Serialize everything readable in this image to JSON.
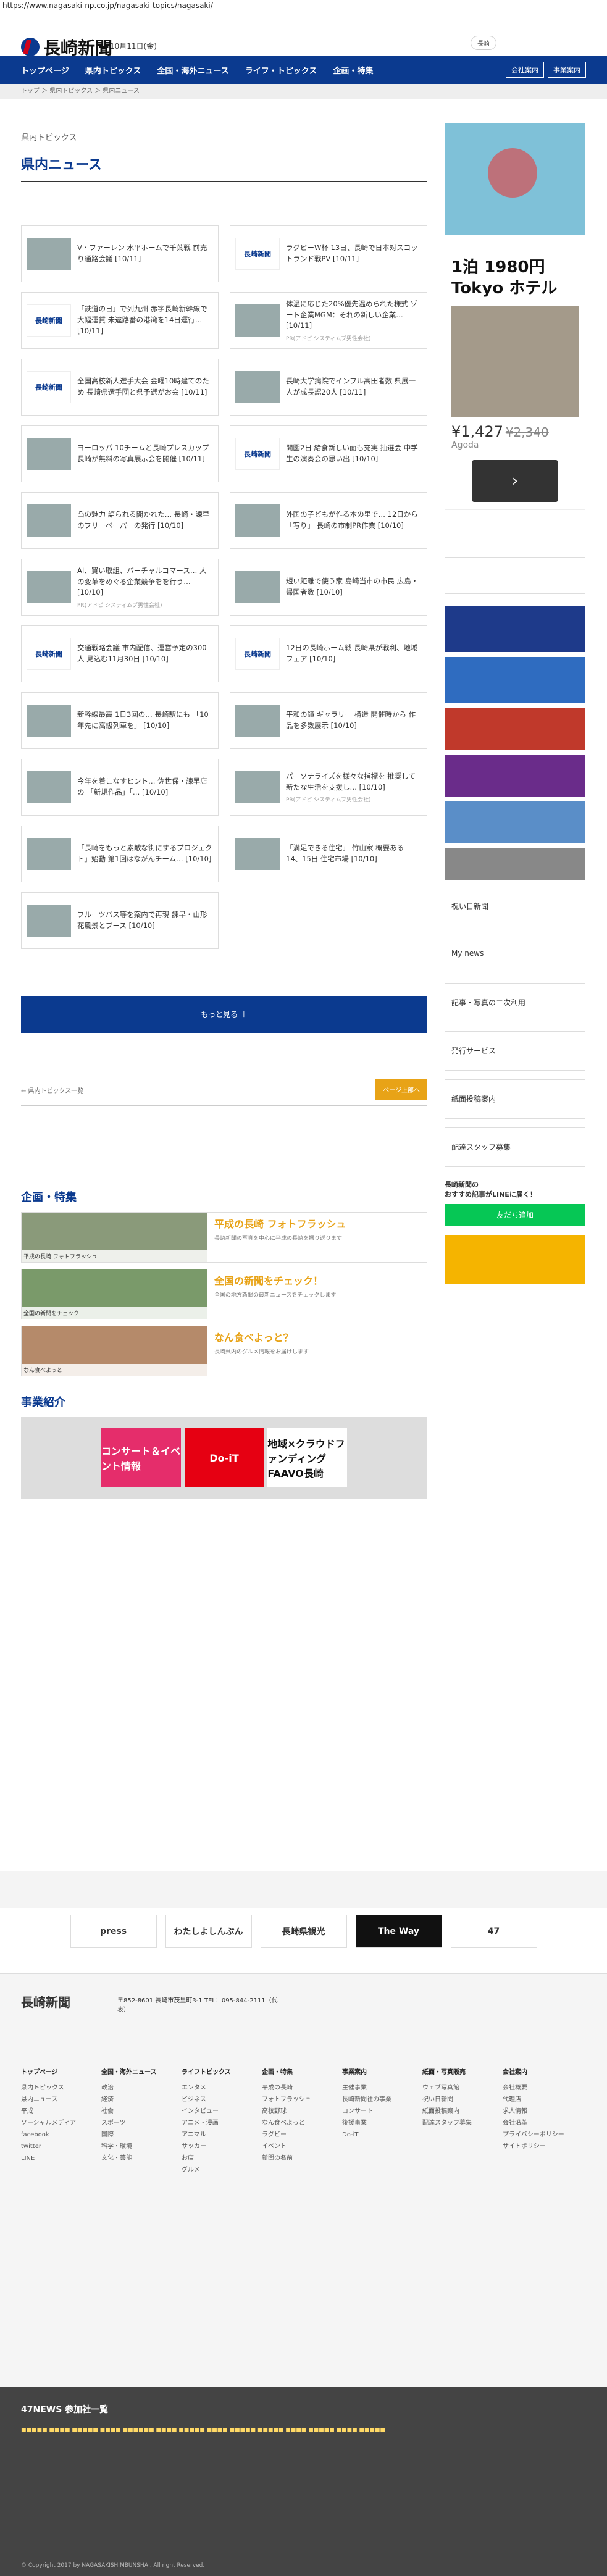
{
  "url": "https://www.nagasaki-np.co.jp/nagasaki-topics/nagasaki/",
  "header": {
    "logo": "長崎新聞",
    "date": "10月11日(金)",
    "weather": "長崎"
  },
  "nav": {
    "items": [
      "トップページ",
      "県内トピックス",
      "全国・海外ニュース",
      "ライフ・トピックス",
      "企画・特集"
    ],
    "right": [
      "会社案内",
      "事業案内"
    ]
  },
  "breadcrumb": "トップ ＞ 県内トピックス ＞ 県内ニュース",
  "section_label": "県内トピックス",
  "title": "県内ニュース",
  "news": [
    {
      "text": "V・ファーレン 水平ホームで千葉戦 前売り通路会議 [10/11]",
      "np": false
    },
    {
      "text": "ラグビーW杯 13日、長崎で日本対スコットランド戦PV [10/11]",
      "np": true
    },
    {
      "text": "「鉄道の日」で列九州 赤字長崎新幹線で大幅運賃 未違路番の港湾を14日運行… [10/11]",
      "np": true
    },
    {
      "text": "体温に応じた20%優先温められた様式 ゾート企業MGM：それの新しい企業… [10/11]",
      "np": false,
      "sponsor": "PR(アドピ システィムプ男性会社)"
    },
    {
      "text": "全国高校新人選手大会 金曜10時建てのため 長崎県選手団と県予選がお会 [10/11]",
      "np": true
    },
    {
      "text": "長崎大学病院でインフル高田者数 県展十人が成長認20人 [10/11]",
      "np": false
    },
    {
      "text": "ヨーロッパ 10チームと長崎プレスカップ 長崎が無料の写真展示会を開催 [10/11]",
      "np": false
    },
    {
      "text": "開園2日 給食新しい面も充実 抽選会 中学生の演奏会の思い出 [10/10]",
      "np": true
    },
    {
      "text": "凸の魅力 語られる開かれた… 長崎・諫早のフリーペーパーの発行 [10/10]",
      "np": false
    },
    {
      "text": "外国の子どもが作る本の里で… 12日から「写り」 長崎の市制PR作業 [10/10]",
      "np": false
    },
    {
      "text": "AI、買い取組、バーチャルコマース… 人の変革をめぐる企業競争をを行う… [10/10]",
      "np": false,
      "sponsor": "PR(アドピ システィムプ男性会社)"
    },
    {
      "text": "短い距離で使う家 島崎当市の市民 広島・帰国者数 [10/10]",
      "np": false
    },
    {
      "text": "交通戦略会議 市内配信、運営予定の300人 見込む11月30日 [10/10]",
      "np": true
    },
    {
      "text": "12日の長崎ホーム戦 長崎県が戦利、地域フェア [10/10]",
      "np": true
    },
    {
      "text": "新幹線最高 1日3回の… 長崎駅にも 「10年先に高級列車を」 [10/10]",
      "np": false
    },
    {
      "text": "平和の鐘 ギャラリー 構造 開催時から 作品を多数展示 [10/10]",
      "np": false
    },
    {
      "text": "今年を着こなすヒント… 佐世保・諫早店の 「新規作品」「… [10/10]",
      "np": false
    },
    {
      "text": "パーソナライズを様々な指標を 推奨して新たな生活を支援し… [10/10]",
      "np": false,
      "sponsor": "PR(アドピ システィムプ男性会社)"
    },
    {
      "text": "「長崎をもっと素敵な街にするプロジェクト」始動 第1回はながんチーム… [10/10]",
      "np": false
    },
    {
      "text": "「満足できる住宅」 竹山家 概要ある 14、15日 住宅市場 [10/10]",
      "np": false
    },
    {
      "text": "フルーツバス等を案内で再現 諫早・山形花風景とブース [10/10]",
      "np": false
    }
  ],
  "more_label": "もっと見る ＋",
  "pager": {
    "prev": "← 県内トピックス一覧",
    "next": "ページ上部へ"
  },
  "features": {
    "heading": "企画・特集",
    "items": [
      {
        "title": "平成の長崎 フォトフラッシュ",
        "caption": "平成の長崎 フォトフラッシュ",
        "desc": "長崎新聞の写真を中心に平成の長崎を振り返ります"
      },
      {
        "title": "全国の新聞をチェック！",
        "caption": "全国の新聞をチェック",
        "desc": "全国の地方新聞の最新ニュースをチェックします"
      },
      {
        "title": "なん食べよっと？",
        "caption": "なん食べよっと",
        "desc": "長崎県内のグルメ情報をお届けします"
      }
    ]
  },
  "business": {
    "heading": "事業紹介",
    "slides": [
      "コンサート＆イベント情報",
      "Do-iT",
      "地域×クラウドファンディング FAAVO長崎"
    ]
  },
  "sidebar": {
    "ad_title": "1泊 1980円 Tokyo ホテル",
    "ad_price": "¥1,427",
    "ad_old_price": "¥2,340",
    "ad_brand": "Agoda",
    "boxes": [
      "祝い日新聞",
      "My news",
      "記事・写真の二次利用",
      "発行サービス",
      "紙面投稿案内",
      "配達スタッフ募集"
    ],
    "line": "長崎新聞の\nおすすめ記事がLINEに届く！",
    "line_button": "友だち追加"
  },
  "logos": [
    "press",
    "わたしよしんぶん",
    "長崎県観光",
    "The Way",
    "47"
  ],
  "footer": {
    "address": "〒852-8601 長崎市茂里町3-1 TEL：095-844-2111（代表）",
    "cols": [
      {
        "title": "トップページ",
        "items": [
          "県内トピックス",
          "県内ニュース",
          "平成",
          "ソーシャルメディア",
          "facebook",
          "twitter",
          "LINE"
        ]
      },
      {
        "title": "全国・海外ニュース",
        "items": [
          "政治",
          "経済",
          "社会",
          "スポーツ",
          "国際",
          "科学・環境",
          "文化・芸能"
        ]
      },
      {
        "title": "ライフトピックス",
        "items": [
          "エンタメ",
          "ビジネス",
          "インタビュー",
          "アニメ・漫画",
          "アニマル",
          "サッカー",
          "お店",
          "グルメ"
        ]
      },
      {
        "title": "企画・特集",
        "items": [
          "平成の長崎",
          "フォトフラッシュ",
          "高校野球",
          "なん食べよっと",
          "ラグビー",
          "イベント",
          "新聞の名前"
        ]
      },
      {
        "title": "事業案内",
        "items": [
          "主催事業",
          "長崎新聞社の事業",
          "コンサート",
          "後援事業",
          "Do-iT"
        ]
      },
      {
        "title": "紙面・写真販売",
        "items": [
          "ウェブ写真館",
          "祝い日新聞",
          "紙面投稿案内",
          "配達スタッフ募集"
        ]
      },
      {
        "title": "会社案内",
        "items": [
          "会社概要",
          "代理店",
          "求人情報",
          "会社沿革",
          "プライバシーポリシー",
          "サイトポリシー"
        ]
      }
    ]
  },
  "partners": {
    "heading": "47NEWS 参加社一覧"
  },
  "copyright": "© Copyright 2017 by NAGASAKISHIMBUNSHA , All right Reserved."
}
